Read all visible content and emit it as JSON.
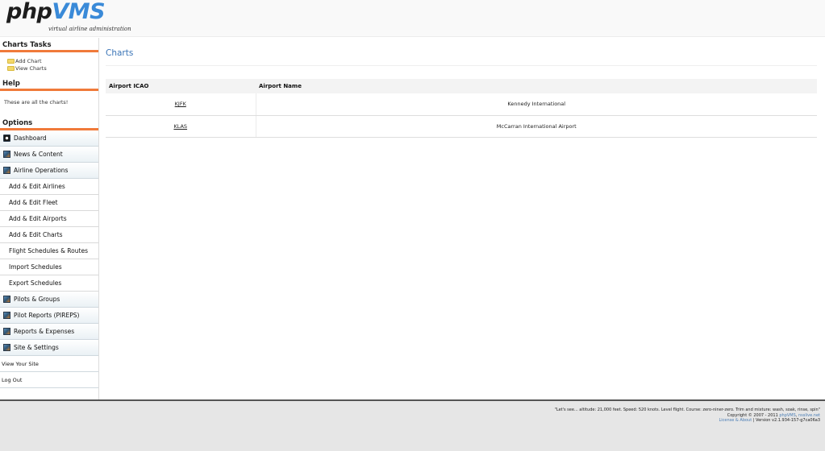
{
  "header": {
    "logo_php": "php",
    "logo_vms": "VMS",
    "tagline": "virtual airline administration"
  },
  "sidebar": {
    "tasks_heading": "Charts Tasks",
    "tasks": [
      {
        "label": "Add Chart",
        "icon": "folder-icon"
      },
      {
        "label": "View Charts",
        "icon": "folder-icon"
      }
    ],
    "help_heading": "Help",
    "help_text": "These are all the charts!",
    "options_heading": "Options",
    "menu": [
      {
        "label": "Dashboard",
        "icon": "dashboard-icon"
      },
      {
        "label": "News & Content",
        "icon": "news-icon"
      },
      {
        "label": "Airline Operations",
        "icon": "airline-icon"
      },
      {
        "label": "Add & Edit Airlines"
      },
      {
        "label": "Add & Edit Fleet"
      },
      {
        "label": "Add & Edit Airports"
      },
      {
        "label": "Add & Edit Charts"
      },
      {
        "label": "Flight Schedules & Routes"
      },
      {
        "label": "Import Schedules"
      },
      {
        "label": "Export Schedules"
      },
      {
        "label": "Pilots & Groups",
        "icon": "pilots-icon"
      },
      {
        "label": "Pilot Reports (PIREPS)",
        "icon": "pireps-icon"
      },
      {
        "label": "Reports & Expenses",
        "icon": "reports-icon"
      },
      {
        "label": "Site & Settings",
        "icon": "settings-icon"
      },
      {
        "label": "View Your Site"
      },
      {
        "label": "Log Out"
      }
    ]
  },
  "main": {
    "title": "Charts",
    "columns": [
      "Airport ICAO",
      "Airport Name"
    ],
    "rows": [
      {
        "icao": "KJFK",
        "name": "Kennedy International"
      },
      {
        "icao": "KLAS",
        "name": "McCarran International Airport"
      }
    ]
  },
  "footer": {
    "quote": "\"Let's see... altitude: 21,000 feet. Speed: 520 knots. Level flight. Course: zero-niner-zero. Trim and mixture: wash, soak, rinse, spin\"",
    "copyright_prefix": "Copyright © 2007 - 2011 ",
    "copyright_link1": "phpVMS",
    "copyright_link2": "nsslive.net",
    "license_link": "License & About",
    "version": " | Version v2.1.934-157-g7ca06a3"
  },
  "colors": {
    "accent": "#3a74b6",
    "heading_underline": "#f07a3a",
    "footer_bg": "#e6e6e6"
  }
}
